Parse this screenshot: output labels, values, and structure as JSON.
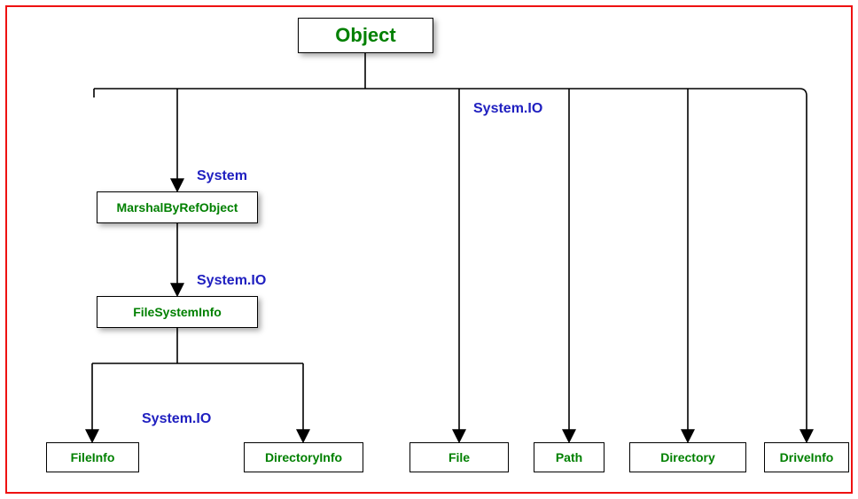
{
  "diagram": {
    "root": "Object",
    "namespaces": {
      "top": "System.IO",
      "systemLeft": "System",
      "ioMid": "System.IO",
      "ioBottom": "System.IO"
    },
    "intermediate": {
      "marshalByRef": "MarshalByRefObject",
      "fileSystemInfo": "FileSystemInfo"
    },
    "leaves": {
      "fileInfo": "FileInfo",
      "directoryInfo": "DirectoryInfo",
      "file": "File",
      "path": "Path",
      "directory": "Directory",
      "driveInfo": "DriveInfo"
    }
  }
}
